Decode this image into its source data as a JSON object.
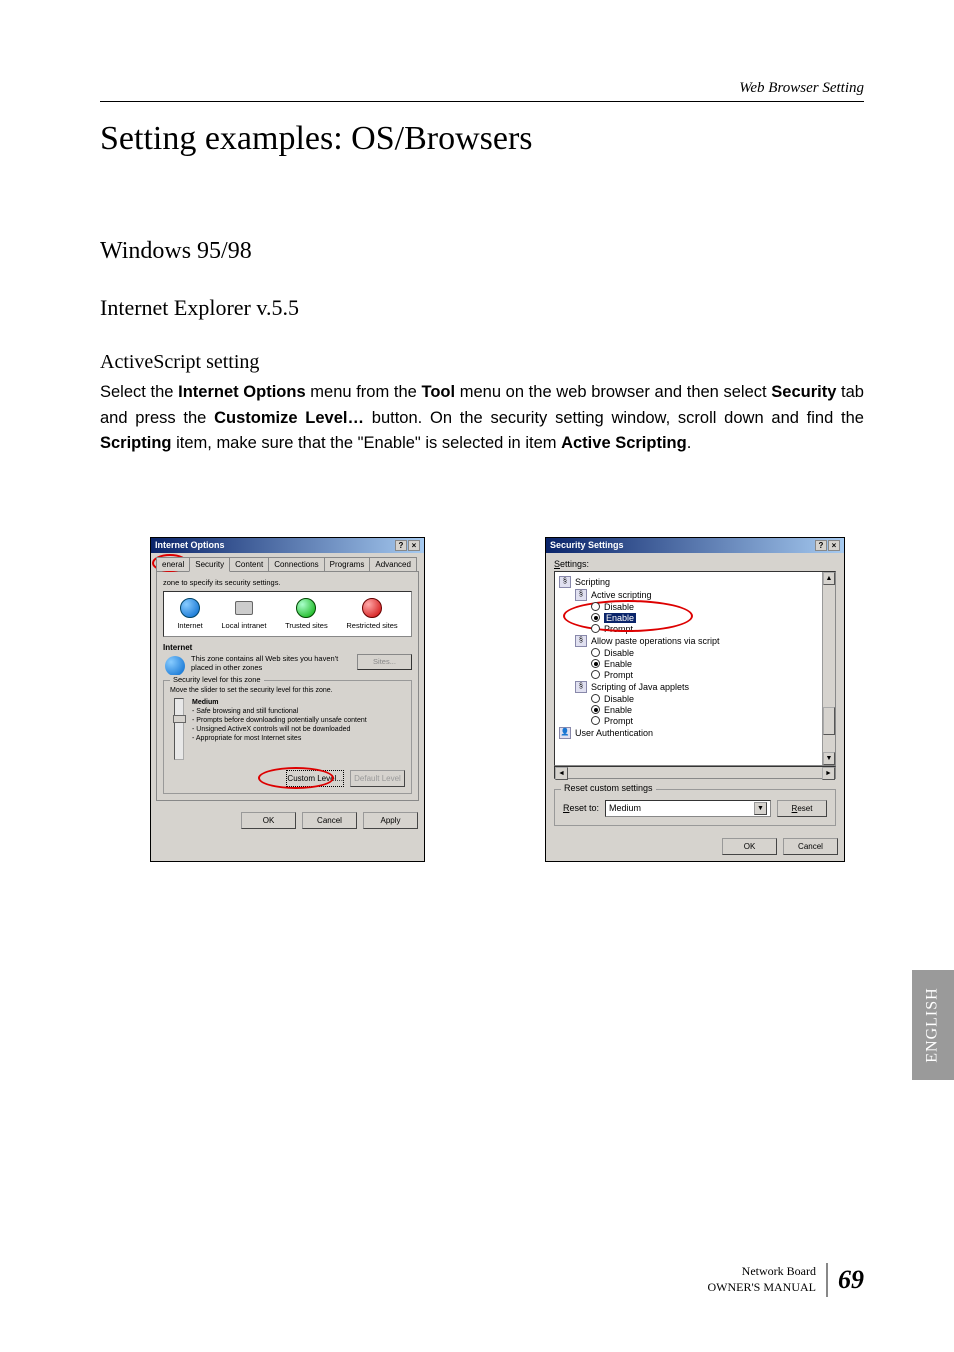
{
  "header": {
    "right": "Web Browser Setting"
  },
  "title": "Setting examples: OS/Browsers",
  "sub1": "Windows 95/98",
  "sub2": "Internet Explorer v.5.5",
  "sub3": "ActiveScript setting",
  "body": {
    "p1_a": "Select the ",
    "p1_b": "Internet Options",
    "p1_c": " menu from the ",
    "p1_d": "Tool",
    "p1_e": " menu on the web browser and then select ",
    "p1_f": "Security",
    "p1_g": " tab and press the ",
    "p1_h": "Customize Level…",
    "p1_i": " button. On the security setting window, scroll down and find the ",
    "p1_j": "Scripting",
    "p1_k": " item, make sure that the \"Enable\" is selected in item ",
    "p1_l": "Active Scripting",
    "p1_m": "."
  },
  "dlg1": {
    "title": "Internet Options",
    "tabs": [
      "eneral",
      "Security",
      "Content",
      "Connections",
      "Programs",
      "Advanced"
    ],
    "hint": "zone to specify its security settings.",
    "zones": {
      "internet": "Internet",
      "intranet": "Local intranet",
      "trusted": "Trusted sites",
      "restricted": "Restricted sites"
    },
    "zone_label": "Internet",
    "zone_desc": "This zone contains all Web sites you haven't placed in other zones",
    "sites": "Sites...",
    "sec_group": "Security level for this zone",
    "sec_hint": "Move the slider to set the security level for this zone.",
    "level": "Medium",
    "bullets": [
      "- Safe browsing and still functional",
      "- Prompts before downloading potentially unsafe content",
      "- Unsigned ActiveX controls will not be downloaded",
      "- Appropriate for most Internet sites"
    ],
    "custom": "Custom Level...",
    "default": "Default Level",
    "ok": "OK",
    "cancel": "Cancel",
    "apply": "Apply"
  },
  "dlg2": {
    "title": "Security Settings",
    "settings_s": "S",
    "settings_rest": "ettings:",
    "tree": {
      "scripting": "Scripting",
      "active_scripting": "Active scripting",
      "disable": "Disable",
      "enable": "Enable",
      "prompt": "Prompt",
      "allow_paste": "Allow paste operations via script",
      "java_applets": "Scripting of Java applets",
      "user_auth": "User Authentication"
    },
    "reset_group": "Reset custom settings",
    "reset_to_r": "R",
    "reset_to_rest": "eset to:",
    "combo": "Medium",
    "reset_btn_r": "R",
    "reset_btn_rest": "eset",
    "ok": "OK",
    "cancel": "Cancel"
  },
  "side": "ENGLISH",
  "footer": {
    "line1": "Network Board",
    "line2": "OWNER'S MANUAL",
    "page": "69"
  }
}
